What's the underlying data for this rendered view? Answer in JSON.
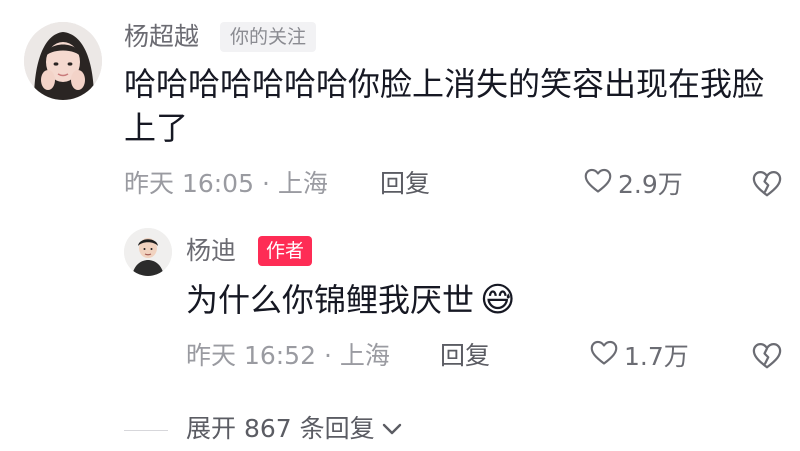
{
  "comments": [
    {
      "user_name": "杨超越",
      "badge": "你的关注",
      "text": "哈哈哈哈哈哈哈你脸上消失的笑容出现在我脸上了",
      "time_location": "昨天 16:05 · 上海",
      "reply_label": "回复",
      "likes": "2.9万"
    },
    {
      "user_name": "杨迪",
      "badge": "作者",
      "text": "为什么你锦鲤我厌世",
      "emoji": "😅",
      "time_location": "昨天 16:52 · 上海",
      "reply_label": "回复",
      "likes": "1.7万"
    }
  ],
  "expand_replies_label": "展开 867 条回复",
  "colors": {
    "author_badge": "#fe2c55",
    "muted_text": "#9a9ba1"
  }
}
